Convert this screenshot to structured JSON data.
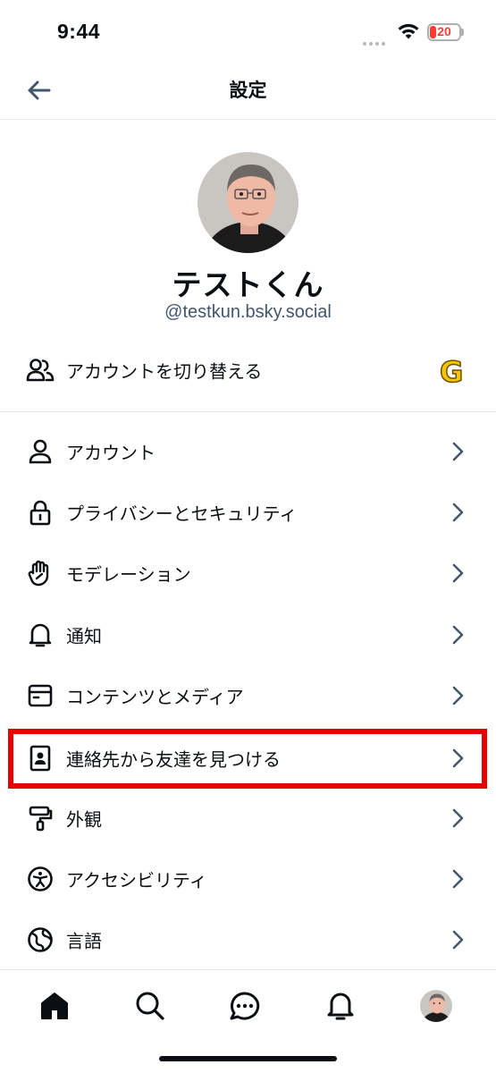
{
  "status_bar": {
    "time": "9:44",
    "battery": "20"
  },
  "header": {
    "title": "設定",
    "back_icon": "arrow-left-icon"
  },
  "profile": {
    "display_name": "テストくん",
    "handle": "@testkun.bsky.social"
  },
  "account_switch": {
    "label": "アカウントを切り替える",
    "icon": "users-icon",
    "badge_letter": "G"
  },
  "settings": [
    {
      "label": "アカウント",
      "icon": "person-icon"
    },
    {
      "label": "プライバシーとセキュリティ",
      "icon": "lock-icon"
    },
    {
      "label": "モデレーション",
      "icon": "hand-icon"
    },
    {
      "label": "通知",
      "icon": "bell-icon"
    },
    {
      "label": "コンテンツとメディア",
      "icon": "window-icon"
    },
    {
      "label": "連絡先から友達を見つける",
      "icon": "contact-book-icon",
      "highlighted": true
    },
    {
      "label": "外観",
      "icon": "paint-roller-icon"
    },
    {
      "label": "アクセシビリティ",
      "icon": "accessibility-icon"
    },
    {
      "label": "言語",
      "icon": "globe-icon"
    }
  ],
  "tabbar": [
    "home-icon",
    "search-icon",
    "chat-icon",
    "bell-icon",
    "avatar"
  ],
  "colors": {
    "accent_gray": "#42576c",
    "highlight": "#e60000",
    "text": "#0b0f14"
  }
}
